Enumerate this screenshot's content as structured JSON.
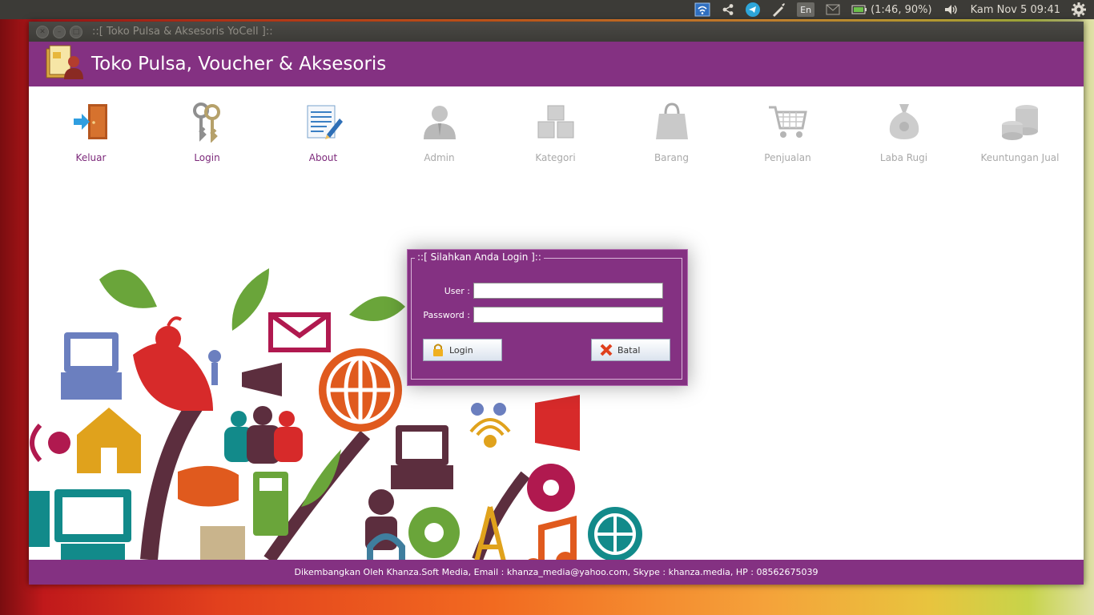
{
  "top_panel": {
    "language": "En",
    "battery": "(1:46, 90%)",
    "clock": "Kam Nov  5 09:41"
  },
  "window": {
    "title": "::[ Toko Pulsa & Aksesoris YoCell ]::",
    "header_title": "Toko Pulsa, Voucher & Aksesoris"
  },
  "toolbar": {
    "items": [
      {
        "label": "Keluar",
        "icon": "exit-door-icon",
        "enabled": true
      },
      {
        "label": "Login",
        "icon": "keys-icon",
        "enabled": true
      },
      {
        "label": "About",
        "icon": "notepad-icon",
        "enabled": true
      },
      {
        "label": "Admin",
        "icon": "user-icon",
        "enabled": false
      },
      {
        "label": "Kategori",
        "icon": "boxes-icon",
        "enabled": false
      },
      {
        "label": "Barang",
        "icon": "shopping-bag-icon",
        "enabled": false
      },
      {
        "label": "Penjualan",
        "icon": "shopping-cart-icon",
        "enabled": false
      },
      {
        "label": "Laba Rugi",
        "icon": "money-bag-icon",
        "enabled": false
      },
      {
        "label": "Keuntungan Jual",
        "icon": "coins-icon",
        "enabled": false
      }
    ]
  },
  "login": {
    "legend": "::[ Silahkan Anda Login ]::",
    "user_label": "User :",
    "user_value": "",
    "password_label": "Password :",
    "password_value": "",
    "login_button": "Login",
    "cancel_button": "Batal"
  },
  "footer": {
    "text": "Dikembangkan Oleh Khanza.Soft Media, Email : khanza_media@yahoo.com, Skype : khanza.media, HP : 08562675039"
  },
  "colors": {
    "accent_purple": "#843182",
    "panel_dark": "#3c3b37"
  }
}
